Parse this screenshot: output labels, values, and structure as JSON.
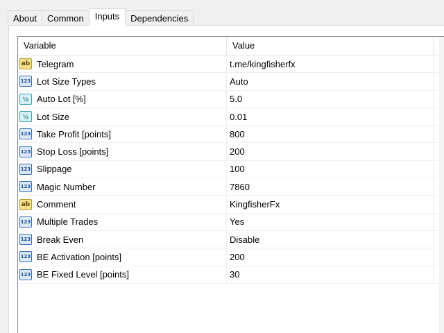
{
  "tabs": [
    {
      "label": "About",
      "active": false
    },
    {
      "label": "Common",
      "active": false
    },
    {
      "label": "Inputs",
      "active": true
    },
    {
      "label": "Dependencies",
      "active": false
    }
  ],
  "table": {
    "columns": {
      "variable": "Variable",
      "value": "Value"
    },
    "rows": [
      {
        "icon": "string-type-icon",
        "icon_text": "ab",
        "variable": "Telegram",
        "value": "t.me/kingfisherfx"
      },
      {
        "icon": "integer-type-icon",
        "icon_text": "123",
        "variable": "Lot Size Types",
        "value": "Auto"
      },
      {
        "icon": "double-type-icon",
        "icon_text": "½",
        "variable": "Auto Lot [%]",
        "value": "5.0"
      },
      {
        "icon": "double-type-icon",
        "icon_text": "½",
        "variable": "Lot Size",
        "value": "0.01"
      },
      {
        "icon": "integer-type-icon",
        "icon_text": "123",
        "variable": "Take Profit [points]",
        "value": "800"
      },
      {
        "icon": "integer-type-icon",
        "icon_text": "123",
        "variable": "Stop Loss [points]",
        "value": "200"
      },
      {
        "icon": "integer-type-icon",
        "icon_text": "123",
        "variable": "Slippage",
        "value": "100"
      },
      {
        "icon": "integer-type-icon",
        "icon_text": "123",
        "variable": "Magic Number",
        "value": "7860"
      },
      {
        "icon": "string-type-icon",
        "icon_text": "ab",
        "variable": "Comment",
        "value": "KingfisherFx"
      },
      {
        "icon": "integer-type-icon",
        "icon_text": "123",
        "variable": "Multiple Trades",
        "value": "Yes"
      },
      {
        "icon": "integer-type-icon",
        "icon_text": "123",
        "variable": "Break Even",
        "value": "Disable"
      },
      {
        "icon": "integer-type-icon",
        "icon_text": "123",
        "variable": "BE Activation [points]",
        "value": "200"
      },
      {
        "icon": "integer-type-icon",
        "icon_text": "123",
        "variable": "BE Fixed Level [points]",
        "value": "30"
      }
    ]
  }
}
